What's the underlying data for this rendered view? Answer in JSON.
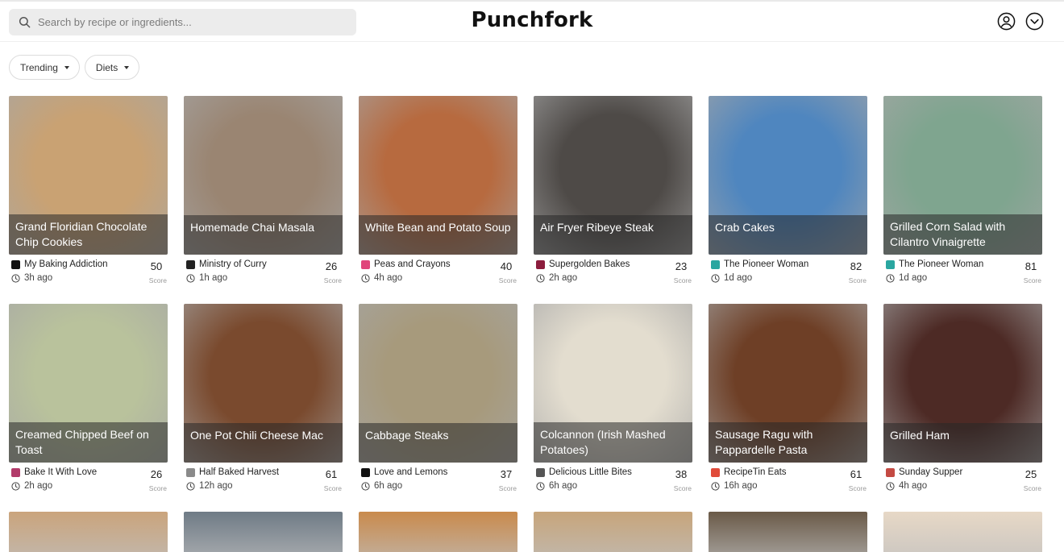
{
  "header": {
    "search_placeholder": "Search by recipe or ingredients...",
    "logo": "Punchfork"
  },
  "filters": [
    {
      "label": "Trending"
    },
    {
      "label": "Diets"
    }
  ],
  "score_label": "Score",
  "recipes": [
    {
      "title": "Grand Floridian Chocolate Chip Cookies",
      "source": "My Baking Addiction",
      "time": "3h ago",
      "score": "50"
    },
    {
      "title": "Homemade Chai Masala",
      "source": "Ministry of Curry",
      "time": "1h ago",
      "score": "26"
    },
    {
      "title": "White Bean and Potato Soup",
      "source": "Peas and Crayons",
      "time": "4h ago",
      "score": "40"
    },
    {
      "title": "Air Fryer Ribeye Steak",
      "source": "Supergolden Bakes",
      "time": "2h ago",
      "score": "23"
    },
    {
      "title": "Crab Cakes",
      "source": "The Pioneer Woman",
      "time": "1d ago",
      "score": "82"
    },
    {
      "title": "Grilled Corn Salad with Cilantro Vinaigrette",
      "source": "The Pioneer Woman",
      "time": "1d ago",
      "score": "81"
    },
    {
      "title": "Creamed Chipped Beef on Toast",
      "source": "Bake It With Love",
      "time": "2h ago",
      "score": "26"
    },
    {
      "title": "One Pot Chili Cheese Mac",
      "source": "Half Baked Harvest",
      "time": "12h ago",
      "score": "61"
    },
    {
      "title": "Cabbage Steaks",
      "source": "Love and Lemons",
      "time": "6h ago",
      "score": "37"
    },
    {
      "title": "Colcannon (Irish Mashed Potatoes)",
      "source": "Delicious Little Bites",
      "time": "6h ago",
      "score": "38"
    },
    {
      "title": "Sausage Ragu with Pappardelle Pasta",
      "source": "RecipeTin Eats",
      "time": "16h ago",
      "score": "61"
    },
    {
      "title": "Grilled Ham",
      "source": "Sunday Supper",
      "time": "4h ago",
      "score": "25"
    }
  ],
  "colors": {
    "card_images": [
      "#c9a273",
      "#9a8572",
      "#b76a3f",
      "#4e4a47",
      "#4f86bf",
      "#7fa58f",
      "#b9c29c",
      "#7a4a2e",
      "#a79a7c",
      "#e3ddcf",
      "#6e3f26",
      "#4d2a25"
    ],
    "source_icons": [
      "#111111",
      "#222222",
      "#e0457b",
      "#8c1d3d",
      "#2aa6a0",
      "#2aa6a0",
      "#b23b6a",
      "#8a8a8a",
      "#111111",
      "#555555",
      "#e04b3a",
      "#c44a43"
    ],
    "row3_images": [
      "#caa47c",
      "#6f7b86",
      "#c98a4c",
      "#c7a57b",
      "#6a5a48",
      "#e7d8c6"
    ]
  }
}
